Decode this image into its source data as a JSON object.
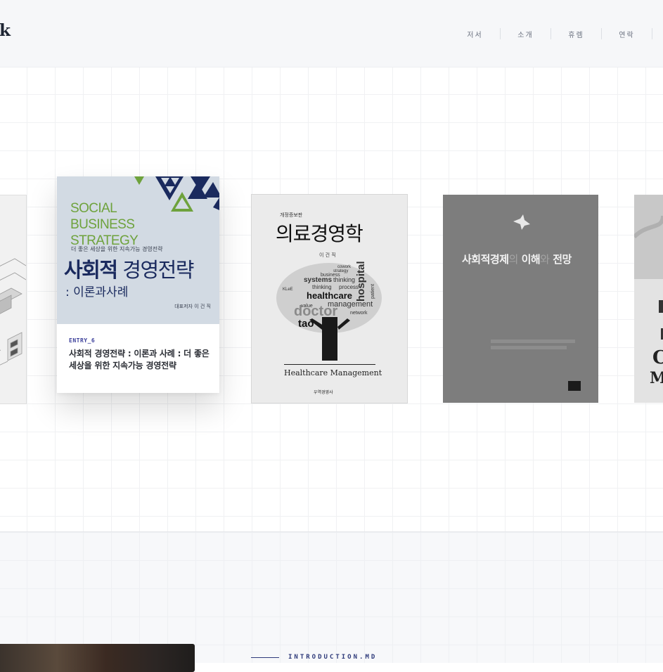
{
  "header": {
    "logo": "k",
    "nav": [
      {
        "label": "저서"
      },
      {
        "label": "소개"
      },
      {
        "label": "휴렘"
      },
      {
        "label": "연락"
      }
    ]
  },
  "featured_book": {
    "cover": {
      "english_title": "SOCIAL BUSINESS STRATEGY",
      "subtitle": "더 좋은 세상을 위한 지속가능 경영전략",
      "korean_title_bold": "사회적",
      "korean_title_rest": "경영전략",
      "korean_subtitle": ": 이론과사례",
      "author": "대표저자 이 건 직"
    },
    "entry_label": "ENTRY_6",
    "title": "사회적 경영전략 : 이론과 사례 : 더 좋은 세상을 위한 지속가능 경영전략"
  },
  "book_2": {
    "edition": "개정증보판",
    "title": "의료경영학",
    "author": "이 건 직",
    "english_title": "Healthcare Management",
    "publisher": "우역경영사",
    "wordcloud": {
      "words": [
        "hospital",
        "systems",
        "thinking",
        "process",
        "healthcare",
        "management",
        "network",
        "doctor",
        "value",
        "strategy",
        "patient",
        "business",
        "tao",
        "KLeE",
        "cowork"
      ]
    }
  },
  "book_3": {
    "title_a": "사회적경제",
    "title_b": "의",
    "title_c": "이해",
    "title_d": "와",
    "title_e": "전망"
  },
  "lower": {
    "intro_label": "INTRODUCTION.MD"
  },
  "colors": {
    "header_bg": "#f6f7f9",
    "accent": "#2e3a7a",
    "cover_green": "#6ea23c",
    "cover_navy": "#1a2a5e"
  }
}
